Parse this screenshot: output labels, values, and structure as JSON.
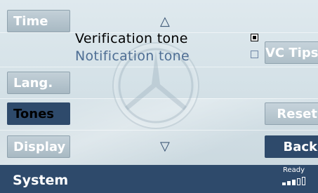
{
  "left_menu": [
    {
      "label": "Time",
      "state": "light"
    },
    {
      "label": "Lang.",
      "state": "light"
    },
    {
      "label": "Tones",
      "state": "active"
    },
    {
      "label": "Display",
      "state": "light"
    }
  ],
  "options": [
    {
      "label": "Verification tone",
      "checked": true
    },
    {
      "label": "Notification tone",
      "checked": false
    }
  ],
  "right_buttons": {
    "vc_tips": "VC Tips",
    "reset": "Reset",
    "back": "Back"
  },
  "scroll": {
    "up_icon": "triangle-up-icon",
    "down_icon": "triangle-down-icon"
  },
  "status": {
    "title": "System",
    "ready": "Ready",
    "signal_icon": "signal-strength-icon"
  },
  "colors": {
    "accent_dark": "#2e4a6b",
    "unselected_text": "#4e6e94",
    "background": "#dfe9ee"
  }
}
